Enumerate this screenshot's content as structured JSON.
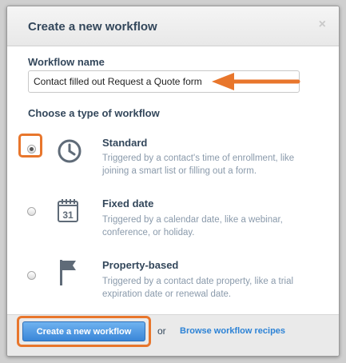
{
  "dialog": {
    "title": "Create a new workflow",
    "close_symbol": "×"
  },
  "name_field": {
    "label": "Workflow name",
    "value": "Contact filled out Request a Quote form"
  },
  "type_section": {
    "label": "Choose a type of workflow",
    "options": [
      {
        "title": "Standard",
        "description": "Triggered by a contact's time of enrollment, like joining a smart list or filling out a form.",
        "icon": "clock-icon",
        "selected": true
      },
      {
        "title": "Fixed date",
        "description": "Triggered by a calendar date, like a webinar, conference, or holiday.",
        "icon": "calendar-icon",
        "calendar_day": "31",
        "selected": false
      },
      {
        "title": "Property-based",
        "description": "Triggered by a contact date property, like a trial expiration date or renewal date.",
        "icon": "flag-icon",
        "selected": false
      }
    ]
  },
  "footer": {
    "create_label": "Create a new workflow",
    "or_text": "or",
    "recipes_link": "Browse workflow recipes"
  },
  "colors": {
    "annotation": "#e8762c",
    "primary_button": "#3a86d8",
    "link": "#2d83d6",
    "text": "#33475b",
    "muted_text": "#8a9aab"
  }
}
